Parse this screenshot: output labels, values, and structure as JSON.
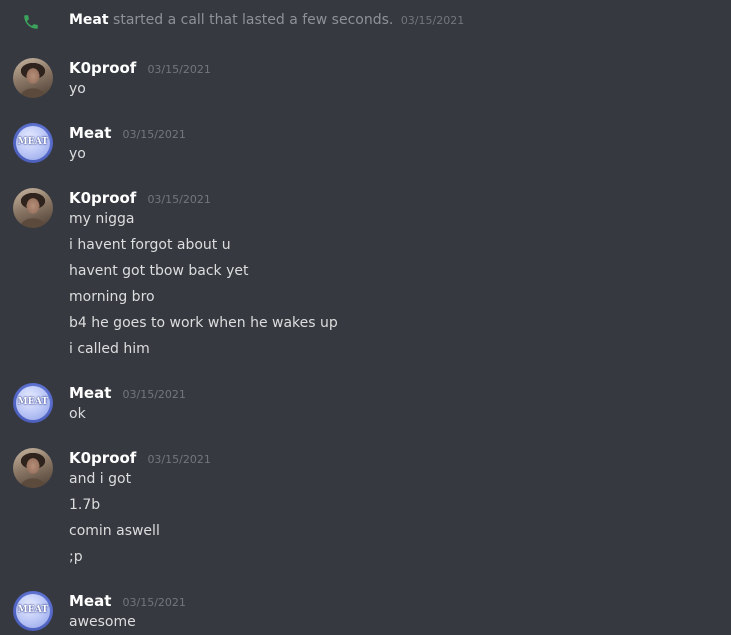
{
  "colors": {
    "background": "#36393f",
    "username": "#ffffff",
    "message_text": "#dcddde",
    "timestamp": "#72767d",
    "call_icon": "#3ba55d"
  },
  "system_message": {
    "icon": "phone-icon",
    "author": "Meat",
    "text": "started a call that lasted a few seconds.",
    "timestamp": "03/15/2021"
  },
  "messages": [
    {
      "author": "K0proof",
      "avatar": "k0proof-avatar",
      "timestamp": "03/15/2021",
      "lines": [
        "yo"
      ]
    },
    {
      "author": "Meat",
      "avatar": "meat-avatar",
      "avatar_text": "MEAT",
      "timestamp": "03/15/2021",
      "lines": [
        "yo"
      ]
    },
    {
      "author": "K0proof",
      "avatar": "k0proof-avatar",
      "timestamp": "03/15/2021",
      "lines": [
        "my nigga",
        "i havent forgot about u",
        "havent got tbow back yet",
        "morning bro",
        "b4 he goes to work when he wakes up",
        "i called him"
      ]
    },
    {
      "author": "Meat",
      "avatar": "meat-avatar",
      "avatar_text": "MEAT",
      "timestamp": "03/15/2021",
      "lines": [
        "ok"
      ]
    },
    {
      "author": "K0proof",
      "avatar": "k0proof-avatar",
      "timestamp": "03/15/2021",
      "lines": [
        "and i got",
        "1.7b",
        "comin aswell",
        ";p"
      ]
    },
    {
      "author": "Meat",
      "avatar": "meat-avatar",
      "avatar_text": "MEAT",
      "timestamp": "03/15/2021",
      "lines": [
        "awesome"
      ]
    }
  ]
}
